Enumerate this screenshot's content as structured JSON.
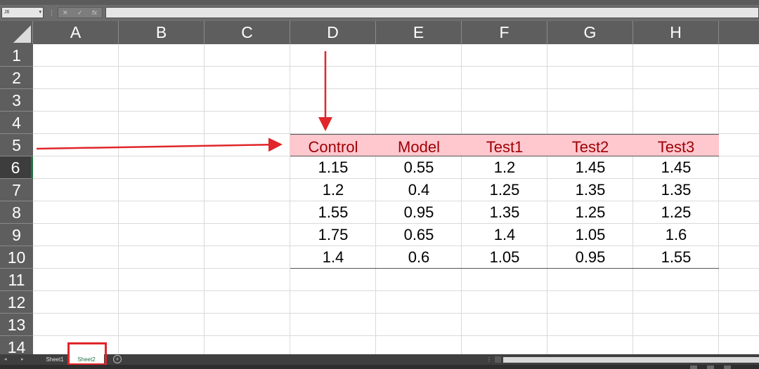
{
  "formula_bar": {
    "name_box": "J6",
    "cancel": "✕",
    "enter": "✓",
    "fx": "fx",
    "formula": ""
  },
  "columns": [
    "A",
    "B",
    "C",
    "D",
    "E",
    "F",
    "G",
    "H"
  ],
  "rows": [
    "1",
    "2",
    "3",
    "4",
    "5",
    "6",
    "7",
    "8",
    "9",
    "10",
    "11",
    "12",
    "13",
    "14"
  ],
  "selected_row": "6",
  "table": {
    "headers": [
      "Control",
      "Model",
      "Test1",
      "Test2",
      "Test3"
    ],
    "rows": [
      [
        "1.15",
        "0.55",
        "1.2",
        "1.45",
        "1.45"
      ],
      [
        "1.2",
        "0.4",
        "1.25",
        "1.35",
        "1.35"
      ],
      [
        "1.55",
        "0.95",
        "1.35",
        "1.25",
        "1.25"
      ],
      [
        "1.75",
        "0.65",
        "1.4",
        "1.05",
        "1.6"
      ],
      [
        "1.4",
        "0.6",
        "1.05",
        "0.95",
        "1.55"
      ]
    ]
  },
  "sheet_tabs": [
    "Sheet1",
    "Sheet2"
  ],
  "active_sheet": "Sheet2",
  "colors": {
    "header_fill": "#ffc7ce",
    "header_text": "#9c0006",
    "annotation": "#e0262a",
    "accent": "#217346"
  }
}
